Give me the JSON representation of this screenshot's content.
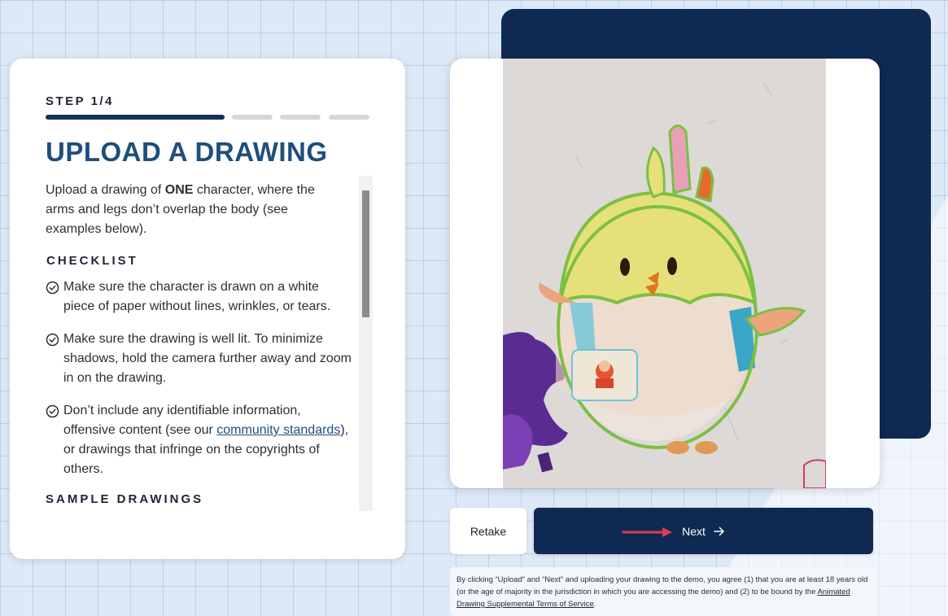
{
  "colors": {
    "navy": "#0e2a53",
    "title_blue": "#1f4e7c",
    "progress_active": "#143256",
    "progress_inactive": "#d4d6d9",
    "annotation_red": "#e03a4e"
  },
  "step_label": "STEP 1/4",
  "progress": {
    "current_step": 1,
    "total_steps": 4
  },
  "title": "UPLOAD A DRAWING",
  "intro": {
    "before": "Upload a drawing of ",
    "emphasis": "ONE",
    "after": " character, where the arms and legs don’t overlap the body (see examples below)."
  },
  "checklist": {
    "heading": "CHECKLIST",
    "icon": "check-circle-icon",
    "item1": "Make sure the character is drawn on a white piece of paper without lines, wrinkles, or tears.",
    "item2": "Make sure the drawing is well lit. To minimize shadows, hold the camera further away and zoom in on the drawing.",
    "item3_before": "Don’t include any identifiable information, offensive content (see our ",
    "item3_link": "community standards",
    "item3_after": "), or drawings that infringe on the copyrights of others."
  },
  "sample_heading": "SAMPLE DRAWINGS",
  "buttons": {
    "retake": "Retake",
    "next": "Next",
    "next_icon": "arrow-right-icon"
  },
  "disclaimer": {
    "text": "By clicking “Upload” and “Next” and uploading your drawing to the demo, you agree (1) that you are at least 18 years old (or the age of majority in the jurisdiction in which you are accessing the demo) and (2) to be bound by the ",
    "link": "Animated Drawing Supplemental Terms of Service",
    "end": "."
  }
}
